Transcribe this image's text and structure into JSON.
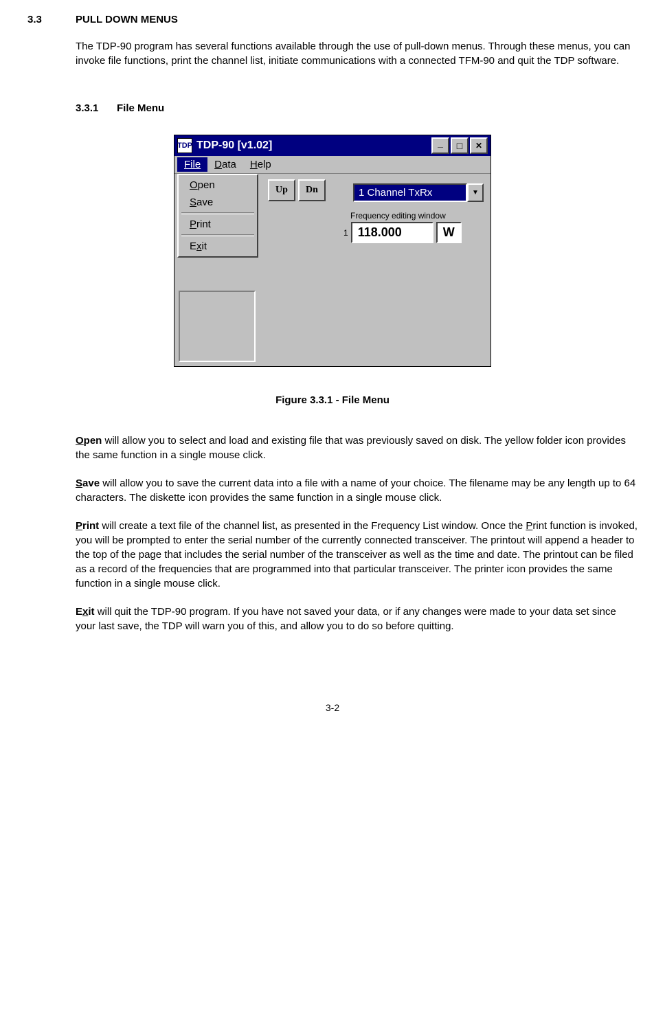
{
  "section": {
    "number": "3.3",
    "title": "PULL DOWN MENUS",
    "intro": "The TDP-90 program has several functions available through the use of pull-down menus. Through these menus, you can invoke file functions, print the channel list, initiate communications with a connected TFM-90 and quit the TDP software."
  },
  "subsection": {
    "number": "3.3.1",
    "title": "File Menu"
  },
  "figure": {
    "caption": "Figure 3.3.1  -  File Menu",
    "window": {
      "title": "TDP-90 [v1.02]",
      "icon_text": "TDP",
      "menubar": {
        "file": "File",
        "data": "Data",
        "help": "Help"
      },
      "dropdown": {
        "open": "Open",
        "save": "Save",
        "print": "Print",
        "exit": "Exit"
      },
      "toolbar": {
        "up": "Up",
        "dn": "Dn"
      },
      "combo": {
        "value": "1 Channel TxRx"
      },
      "tooltip": "Frequency editing window",
      "freq": {
        "index": "1",
        "value": "118.000",
        "mode": "W"
      }
    }
  },
  "paragraphs": {
    "open": {
      "lead_underline": "O",
      "lead_rest": "pen",
      "text": " will allow you to select and load and existing file that was previously saved on disk. The yellow folder icon provides the same function in a single mouse click."
    },
    "save": {
      "lead_underline": "S",
      "lead_rest": "ave",
      "text": " will allow you to save the current data into a file with a name of your choice. The filename may be any length up to 64 characters.  The diskette icon provides the same function in a single mouse click."
    },
    "print": {
      "lead_underline": "P",
      "lead_rest": "rint",
      "text_before": " will create a text file of the channel list, as presented in the Frequency List window. Once the ",
      "inline_underline": "P",
      "inline_rest": "rint",
      "text_after": " function is invoked, you will be prompted to enter the serial number of the currently connected transceiver. The printout will append a header to the top of the page that includes the serial number of the transceiver as well as the time and date. The printout can be filed as a record of the frequencies that are programmed into that particular transceiver. The printer icon provides the same function in a single mouse click."
    },
    "exit": {
      "lead_before": "E",
      "lead_underline": "x",
      "lead_after": "it",
      "text": " will quit the TDP-90 program. If you have not saved your data, or if any changes were made to your data set since your last save, the TDP will warn you of this, and allow you to do so before quitting."
    }
  },
  "page_number": "3-2"
}
